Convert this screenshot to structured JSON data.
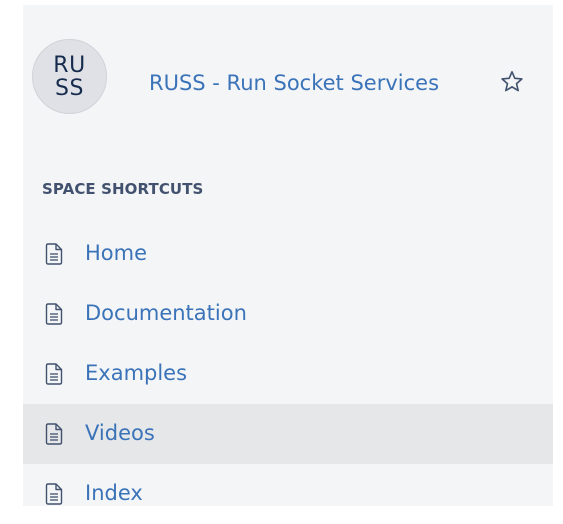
{
  "space": {
    "avatar_line1": "RU",
    "avatar_line2": "SS",
    "title": "RUSS - Run Socket Services",
    "star_icon": "star-outline-icon"
  },
  "shortcuts": {
    "heading": "SPACE SHORTCUTS",
    "items": [
      {
        "label": "Home",
        "icon": "page-icon",
        "active": false
      },
      {
        "label": "Documentation",
        "icon": "page-icon",
        "active": false
      },
      {
        "label": "Examples",
        "icon": "page-icon",
        "active": false
      },
      {
        "label": "Videos",
        "icon": "page-icon",
        "active": true
      },
      {
        "label": "Index",
        "icon": "page-icon",
        "active": false
      }
    ]
  },
  "colors": {
    "link": "#3b73b9",
    "heading": "#42526e",
    "panel_background": "#f4f5f7",
    "active_row": "#e6e7e9"
  }
}
